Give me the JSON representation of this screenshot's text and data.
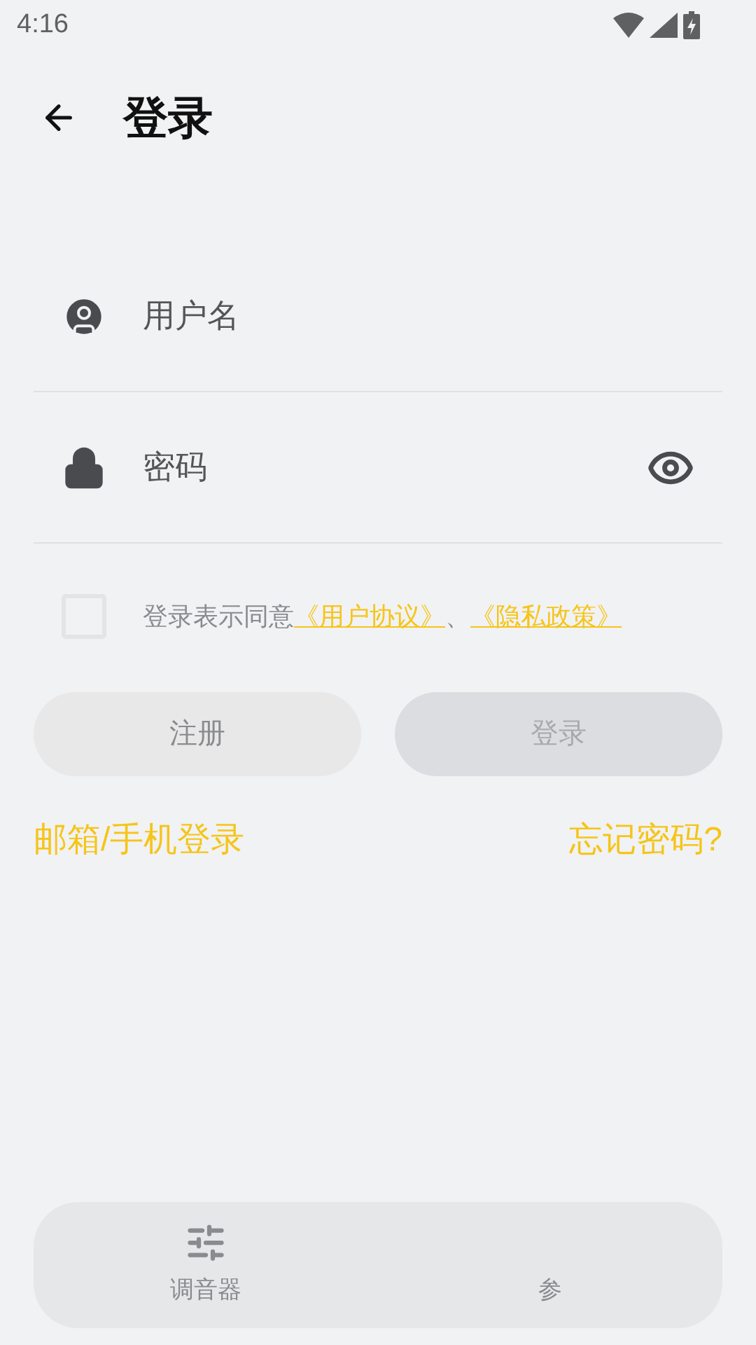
{
  "status_bar": {
    "time": "4:16"
  },
  "header": {
    "title": "登录"
  },
  "fields": [
    {
      "kind": "user",
      "placeholder": "用户名"
    },
    {
      "kind": "password",
      "placeholder": "密码"
    }
  ],
  "agreement": {
    "checked": false,
    "text": "登录表示同意",
    "links": [
      "《用户协议》",
      "《隐私政策》"
    ],
    "separator": "、"
  },
  "buttons": [
    {
      "label": "注册",
      "disabled": false
    },
    {
      "label": "登录",
      "disabled": true
    }
  ],
  "links": [
    "邮箱/手机登录",
    "忘记密码?"
  ],
  "bottom_nav": [
    {
      "label": "调音器",
      "kind": "icon-tab"
    },
    {
      "label": "参",
      "kind": "partial"
    }
  ]
}
